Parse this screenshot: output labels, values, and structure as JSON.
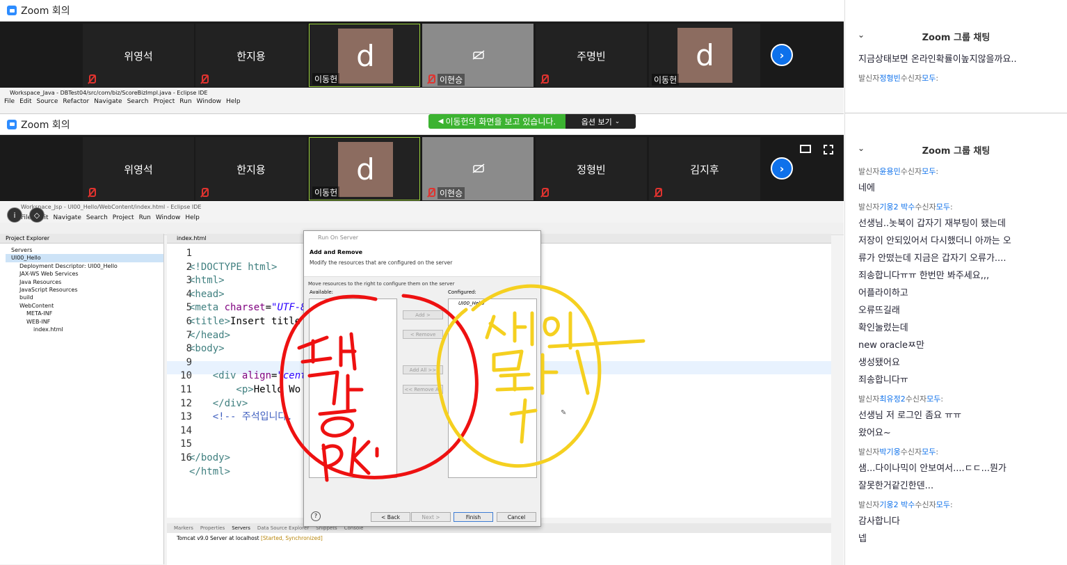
{
  "window": {
    "title": "Zoom 회의",
    "min": "—",
    "max": "☐",
    "close": "✕"
  },
  "top_gallery": {
    "participants": [
      {
        "name": "위영석",
        "label": ""
      },
      {
        "name": "한지용",
        "label": ""
      },
      {
        "name": "",
        "avatar": "d",
        "label": "이동헌"
      },
      {
        "name": "",
        "label": "이현승"
      },
      {
        "name": "주명빈",
        "label": ""
      },
      {
        "name": "",
        "avatar": "d",
        "label": "이동헌"
      }
    ]
  },
  "bottom_gallery": {
    "participants": [
      {
        "name": "위영석",
        "label": ""
      },
      {
        "name": "한지용",
        "label": ""
      },
      {
        "name": "",
        "avatar": "d",
        "label": "이동헌"
      },
      {
        "name": "",
        "label": "이현승"
      },
      {
        "name": "정형빈",
        "label": ""
      },
      {
        "name": "김지후",
        "label": ""
      }
    ]
  },
  "share_banner": {
    "text": "이동헌의 화면을 보고 있습니다.",
    "options": "옵션 보기"
  },
  "eclipse_top": {
    "title": "Workspace_Java - DBTest04/src/com/biz/ScoreBizImpl.java - Eclipse IDE",
    "menu": [
      "File",
      "Edit",
      "Source",
      "Refactor",
      "Navigate",
      "Search",
      "Project",
      "Run",
      "Window",
      "Help"
    ]
  },
  "eclipse": {
    "title": "Workspace_Jsp - UI00_Hello/WebContent/index.html - Eclipse IDE",
    "menu": [
      "File",
      "Edit",
      "Navigate",
      "Search",
      "Project",
      "Run",
      "Window",
      "Help"
    ],
    "project_explorer": "Project Explorer",
    "tree": [
      "Servers",
      "UI00_Hello",
      "Deployment Descriptor: UI00_Hello",
      "JAX-WS Web Services",
      "Java Resources",
      "JavaScript Resources",
      "build",
      "WebContent",
      "META-INF",
      "WEB-INF",
      "index.html"
    ],
    "editor_tab": "index.html",
    "code_lines": [
      "1",
      "2",
      "3",
      "4",
      "5",
      "6",
      "7",
      "8",
      "9",
      "10",
      "11",
      "12",
      "13",
      "14",
      "15",
      "16"
    ],
    "code": {
      "l1": "<!DOCTYPE html>",
      "l2": "<html>",
      "l3": "<head>",
      "l4a": "<meta ",
      "l4b": "charset",
      "l4c": "=",
      "l4d": "\"UTF-8\"",
      "l5a": "<title>",
      "l5b": "Insert title",
      "l6": "</head>",
      "l7": "<body>",
      "l9a": "    <div ",
      "l9b": "align",
      "l9c": "=",
      "l9d": "\"cent",
      "l10a": "        <p>",
      "l10b": "Hello Wo",
      "l11": "    </div>",
      "l12": "    <!-- 주석입니다.",
      "l15": "</body>",
      "l16": "</html>"
    },
    "bottom_tabs": [
      "Markers",
      "Properties",
      "Servers",
      "Data Source Explorer",
      "Snippets",
      "Console"
    ],
    "server_line": "Tomcat v9.0 Server at localhost",
    "server_status": "[Started, Synchronized]"
  },
  "dialog": {
    "title": "Run On Server",
    "heading": "Add and Remove",
    "desc": "Modify the resources that are configured on the server",
    "move": "Move resources to the right to configure them on the server",
    "available": "Available:",
    "configured": "Configured:",
    "configured_item": "UI00_Hello",
    "btn_add": "Add >",
    "btn_remove": "< Remove",
    "btn_addall": "Add All >>",
    "btn_removeall": "<< Remove All",
    "btn_back": "< Back",
    "btn_next": "Next >",
    "btn_finish": "Finish",
    "btn_cancel": "Cancel",
    "help": "?"
  },
  "chat_top": {
    "title": "Zoom 그룹 채팅",
    "msg": "지금상태보면 온라인확률이높지않을까요..",
    "meta_prefix": "발신자",
    "meta_name": "정형빈",
    "meta_mid": "수신자",
    "meta_to": "모두",
    "meta_colon": ":"
  },
  "chat": {
    "title": "Zoom 그룹 채팅",
    "groups": [
      {
        "sender": "윤용민",
        "lines": [
          "네에"
        ]
      },
      {
        "sender": "기웅2 박수",
        "lines": [
          "선생님..놋북이 갑자기 재부팅이 됐는데",
          "저장이 안되있어서 다시했더니 아까는 오",
          "류가 안떴는데 지금은 갑자기 오류가....",
          "죄송합니다ㅠㅠ 한번만 봐주세요,,,",
          "어플라이하고",
          "오류뜨길래",
          "확인눌렀는데",
          "new oracleㅉ만",
          "생성됐어요",
          "죄송합니다ㅠ"
        ]
      },
      {
        "sender": "최유정2",
        "lines": [
          "선생님 저 로그인 좀요 ㅠㅠ",
          "왔어요~"
        ]
      },
      {
        "sender": "박기웅",
        "lines": [
          "샘...다이나믹이 안보여서....ㄷㄷ...뭔가",
          "잘못한거같긴한덴..."
        ]
      },
      {
        "sender": "기웅2 박수",
        "lines": [
          "감사합니다",
          "넵"
        ]
      }
    ],
    "meta_prefix": "발신자",
    "meta_mid": "수신자",
    "meta_to": "모두",
    "meta_colon": ":"
  },
  "annotations": {
    "red": "서버 가능 PK",
    "yellow": "서버 몰라가"
  },
  "colors": {
    "zoom_blue": "#0e71eb",
    "active_green": "#9ad33a",
    "muted_red": "#e0332f",
    "share_green": "#3cb331",
    "ink_red": "#ee1111",
    "ink_yellow": "#f5d020"
  }
}
